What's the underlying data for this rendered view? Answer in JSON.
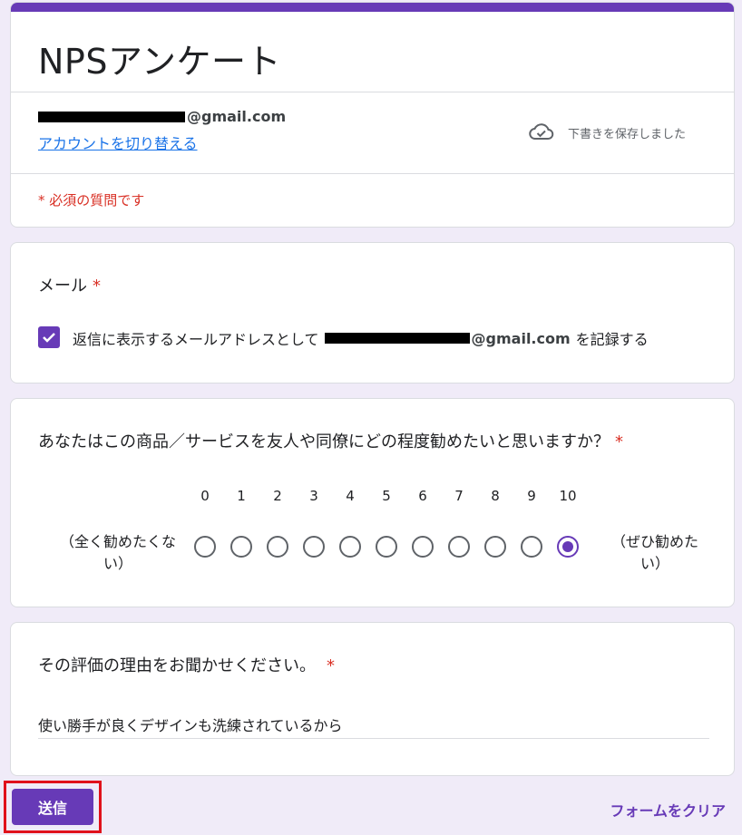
{
  "header": {
    "title": "NPSアンケート",
    "account_email_suffix": "@gmail.com",
    "switch_account": "アカウントを切り替える",
    "draft_status": "下書きを保存しました",
    "required_note": "* 必須の質問です",
    "accent_color": "#673ab7"
  },
  "email_question": {
    "title": "メール",
    "required_mark": "*",
    "checkbox_checked": true,
    "label_prefix": "返信に表示するメールアドレスとして",
    "email_suffix": "@gmail.com",
    "label_suffix": "を記録する"
  },
  "nps_question": {
    "title": "あなたはこの商品／サービスを友人や同僚にどの程度勧めたいと思いますか？",
    "required_mark": "*",
    "scale": [
      "0",
      "1",
      "2",
      "3",
      "4",
      "5",
      "6",
      "7",
      "8",
      "9",
      "10"
    ],
    "selected_index": 10,
    "low_label": "（全く勧めたくない）",
    "high_label": "（ぜひ勧めたい）"
  },
  "reason_question": {
    "title": "その評価の理由をお聞かせください。",
    "required_mark": "*",
    "answer": "使い勝手が良くデザインも洗練されているから"
  },
  "footer": {
    "submit_label": "送信",
    "clear_label": "フォームをクリア"
  },
  "icons": {
    "cloud": "cloud-check-icon",
    "checkbox": "check-icon"
  }
}
